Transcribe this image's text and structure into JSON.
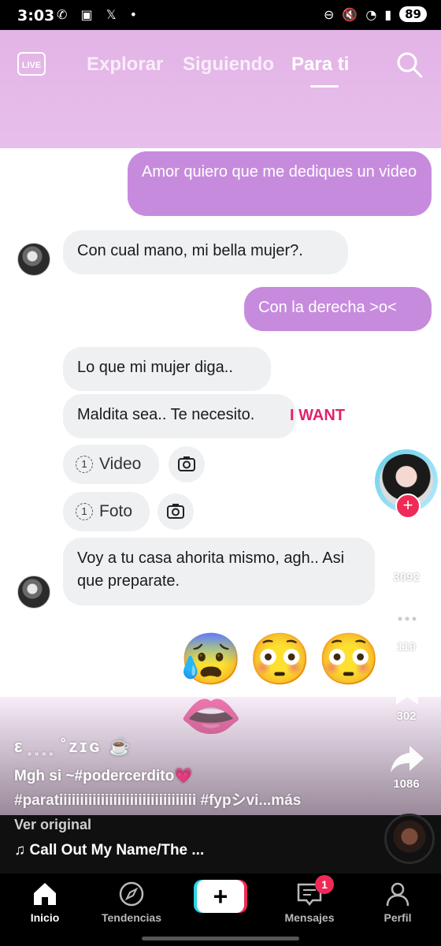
{
  "status_bar": {
    "time": "3:03",
    "notif_icons": "✆ ▣ 𝕏 •",
    "battery": "89"
  },
  "header": {
    "live_label": "LIVE",
    "tabs": [
      {
        "label": "Explorar"
      },
      {
        "label": "Siguiendo"
      },
      {
        "label": "Para ti"
      }
    ]
  },
  "chat": {
    "messages": [
      {
        "text": "Amor quiero que me dediques un video"
      },
      {
        "text": "Con cual mano, mi bella mujer?."
      },
      {
        "text": "Con la derecha >o<"
      },
      {
        "text": "Lo que mi mujer diga.."
      },
      {
        "text": "Maldita sea.. Te necesito."
      },
      {
        "text": "Voy a tu casa ahorita mismo, agh.. Asi que preparate."
      }
    ],
    "want_text": "I WANT",
    "chips": [
      {
        "num": "1",
        "label": "Video"
      },
      {
        "num": "1",
        "label": "Foto"
      }
    ],
    "emojis": "😰😳😳👄"
  },
  "rail": {
    "likes": "3092",
    "comments": "110",
    "saves": "302",
    "shares": "1086",
    "follow_symbol": "+"
  },
  "caption": {
    "username": "ε ̥ ̥ ̥ ̥ ˚zɪɢ ☕",
    "line1": "Mgh si ~#podercerdito💗",
    "line2": "#paratiiiiiiiiiiiiiiiiiiiiiiiiiiiiiiiii #fypシvi...más"
  },
  "music": {
    "ver_original": "Ver original",
    "song": "♫ Call Out My Name/The ..."
  },
  "nav": {
    "items": [
      {
        "label": "Inicio"
      },
      {
        "label": "Tendencias"
      },
      {
        "label": "+"
      },
      {
        "label": "Mensajes"
      },
      {
        "label": "Perfil"
      }
    ],
    "messages_badge": "1"
  }
}
